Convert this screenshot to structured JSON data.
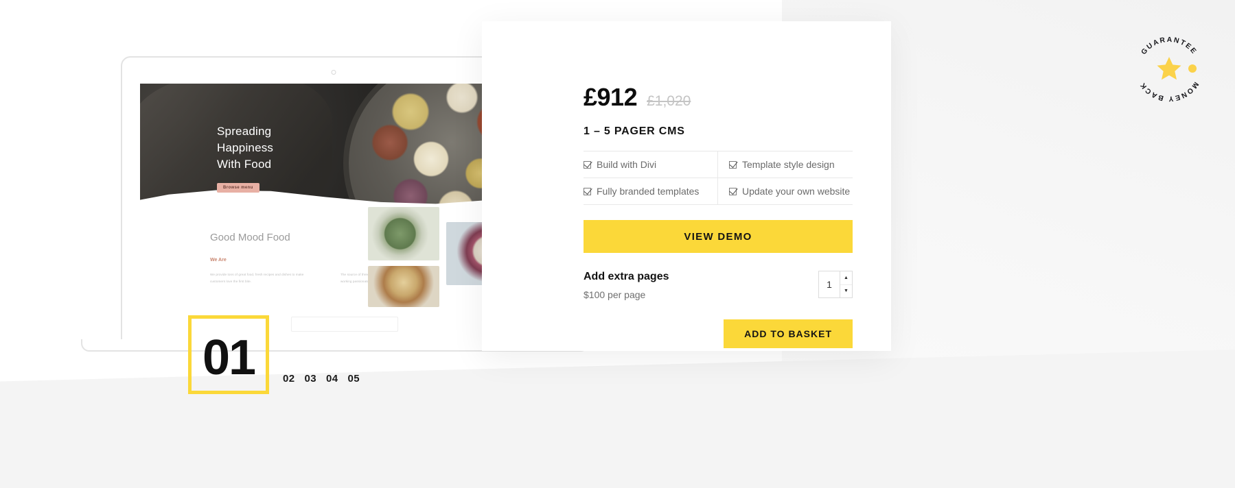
{
  "product": {
    "price_current": "£912",
    "price_original": "£1,020",
    "title": "1 – 5 PAGER CMS",
    "features": [
      "Build with Divi",
      "Template style design",
      "Fully branded templates",
      "Update your own website"
    ],
    "view_demo_label": "VIEW DEMO",
    "extras": {
      "heading": "Add extra pages",
      "price_note": "$100 per page",
      "quantity": "1",
      "increment_glyph": "▲",
      "decrement_glyph": "▼"
    },
    "add_to_basket_label": "ADD TO BASKET"
  },
  "badge": {
    "top_arc_text": "GUARANTEE",
    "bottom_arc_text": "MONEY BACK",
    "star_glyph": "★"
  },
  "pagination": {
    "active": "01",
    "items": [
      "02",
      "03",
      "04",
      "05"
    ]
  },
  "preview": {
    "hero_line1": "Spreading",
    "hero_line2": "Happiness",
    "hero_line3": "With Food",
    "hero_button": "Browse menu",
    "section_heading": "Good Mood Food",
    "section_sub": "We Are",
    "body_left": "We provide tons of great food, fresh recipes and dishes to make customers love the first bite.",
    "body_right": "The source of three qualified meals are supported for us and working passionate online."
  },
  "colors": {
    "accent": "#fbd839",
    "text_dark": "#121212",
    "text_muted": "#6a6a6a",
    "strike": "#c4c4c4"
  }
}
